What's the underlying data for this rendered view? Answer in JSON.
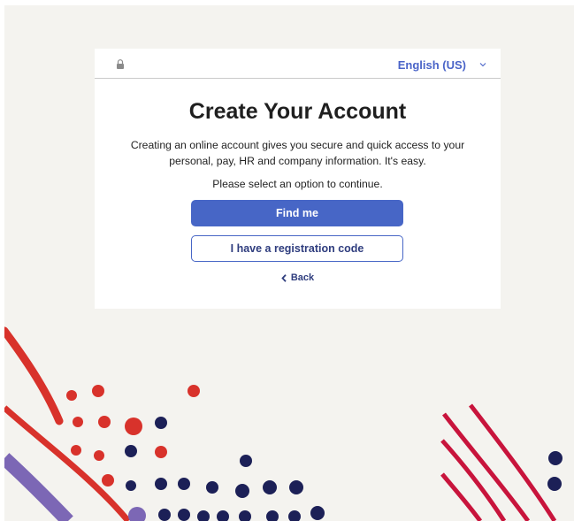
{
  "header": {
    "lock_icon": "lock-icon",
    "language_selected": "English (US)",
    "chevron_icon": "chevron-down-icon"
  },
  "main": {
    "title": "Create Your Account",
    "description": "Creating an online account gives you secure and quick access to your personal, pay, HR and company information. It's easy.",
    "prompt": "Please select an option to continue.",
    "find_me_label": "Find me",
    "registration_code_label": "I have a registration code",
    "back_label": "Back",
    "back_icon": "chevron-left-icon"
  },
  "colors": {
    "background": "#f4f3ef",
    "primary": "#4766c6",
    "link": "#4a64c8",
    "decor_red": "#d8322b",
    "decor_navy": "#1c2057",
    "decor_purple": "#7c67b5",
    "decor_crimson": "#c8143c"
  }
}
